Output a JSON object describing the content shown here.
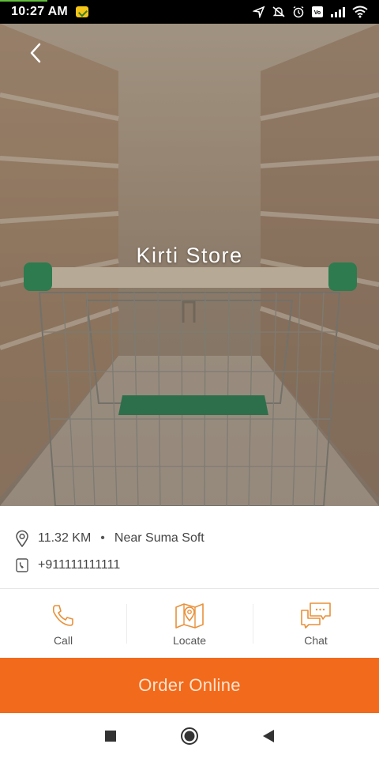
{
  "status_bar": {
    "time": "10:27 AM",
    "icons": [
      "app-notification-icon",
      "navigation-icon",
      "mute-icon",
      "alarm-icon",
      "volte-icon",
      "signal-icon",
      "wifi-icon"
    ]
  },
  "hero": {
    "store_name": "Kirti Store",
    "back_icon": "back-arrow-icon"
  },
  "info": {
    "distance": "11.32 KM",
    "separator": "•",
    "landmark": "Near Suma Soft",
    "phone": "+911111111111"
  },
  "actions": [
    {
      "label": "Call",
      "icon": "phone-icon"
    },
    {
      "label": "Locate",
      "icon": "map-pin-icon"
    },
    {
      "label": "Chat",
      "icon": "chat-icon"
    }
  ],
  "order_button": {
    "label": "Order Online"
  },
  "colors": {
    "accent": "#f26a1b",
    "icon_orange": "#e8913a",
    "text": "#444444"
  },
  "navbar": [
    "recent-apps-icon",
    "home-icon",
    "back-icon"
  ]
}
